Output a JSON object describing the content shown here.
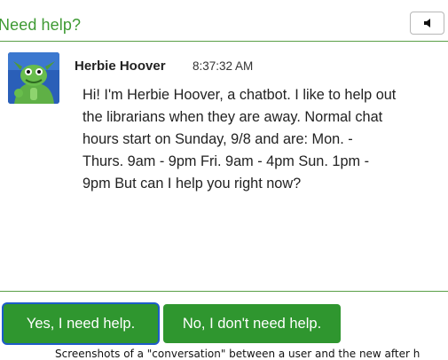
{
  "header": {
    "title": "Need help?",
    "sound_icon": "speaker-icon"
  },
  "message": {
    "sender": "Herbie Hoover",
    "time": "8:37:32 AM",
    "avatar": "green-dragon-mascot",
    "lines": [
      "Hi! I'm Herbie Hoover, a chatbot. I like to help out",
      "the librarians when they are away. Normal chat",
      "hours start on Sunday, 9/8 and are: Mon. -",
      "Thurs. 9am - 9pm Fri. 9am - 4pm Sun. 1pm -",
      "9pm But can I help you right now?"
    ]
  },
  "buttons": {
    "yes": "Yes, I need help.",
    "no": "No, I don't need help."
  },
  "caption": "Screenshots of a \"conversation\" between a user and the new after h",
  "colors": {
    "accent": "#3e9a33",
    "button": "#2f962f",
    "focus_ring": "#1e5cc9"
  }
}
